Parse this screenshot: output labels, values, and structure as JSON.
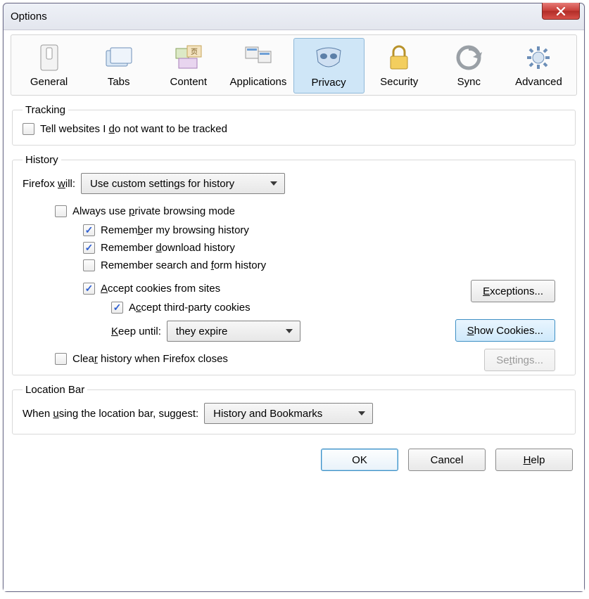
{
  "window": {
    "title": "Options"
  },
  "tabs": {
    "general": {
      "label": "General"
    },
    "tabs": {
      "label": "Tabs"
    },
    "content": {
      "label": "Content"
    },
    "applications": {
      "label": "Applications"
    },
    "privacy": {
      "label": "Privacy"
    },
    "security": {
      "label": "Security"
    },
    "sync": {
      "label": "Sync"
    },
    "advanced": {
      "label": "Advanced"
    }
  },
  "tracking": {
    "legend": "Tracking",
    "tell_sites": {
      "checked": false,
      "pre": "Tell websites I ",
      "ul": "d",
      "post": "o not want to be tracked"
    }
  },
  "history": {
    "legend": "History",
    "firefox_will_pre": "Firefox ",
    "firefox_will_ul": "w",
    "firefox_will_post": "ill:",
    "mode_value": "Use custom settings for history",
    "always_private": {
      "checked": false,
      "pre": "Always use ",
      "ul": "p",
      "post": "rivate browsing mode"
    },
    "remember_browsing": {
      "checked": true,
      "pre": "Remem",
      "ul": "b",
      "post": "er my browsing history"
    },
    "remember_download": {
      "checked": true,
      "pre": "Remember ",
      "ul": "d",
      "post": "ownload history"
    },
    "remember_search_form": {
      "checked": false,
      "pre": "Remember search and ",
      "ul": "f",
      "post": "orm history"
    },
    "accept_cookies": {
      "checked": true,
      "ul": "A",
      "post": "ccept cookies from sites"
    },
    "accept_third_party": {
      "checked": true,
      "pre": "A",
      "ul": "c",
      "post": "cept third-party cookies"
    },
    "keep_until_ul": "K",
    "keep_until_post": "eep until:",
    "keep_until_value": "they expire",
    "clear_on_close": {
      "checked": false,
      "pre": "Clea",
      "ul": "r",
      "post": " history when Firefox closes"
    },
    "exceptions_btn_ul": "E",
    "exceptions_btn_post": "xceptions...",
    "show_cookies_btn_ul": "S",
    "show_cookies_btn_post": "how Cookies...",
    "settings_btn_pre": "Se",
    "settings_btn_ul": "t",
    "settings_btn_post": "tings..."
  },
  "location_bar": {
    "legend": "Location Bar",
    "label_pre": "When ",
    "label_ul": "u",
    "label_post": "sing the location bar, suggest:",
    "value": "History and Bookmarks"
  },
  "footer": {
    "ok": "OK",
    "cancel": "Cancel",
    "help_ul": "H",
    "help_post": "elp"
  }
}
